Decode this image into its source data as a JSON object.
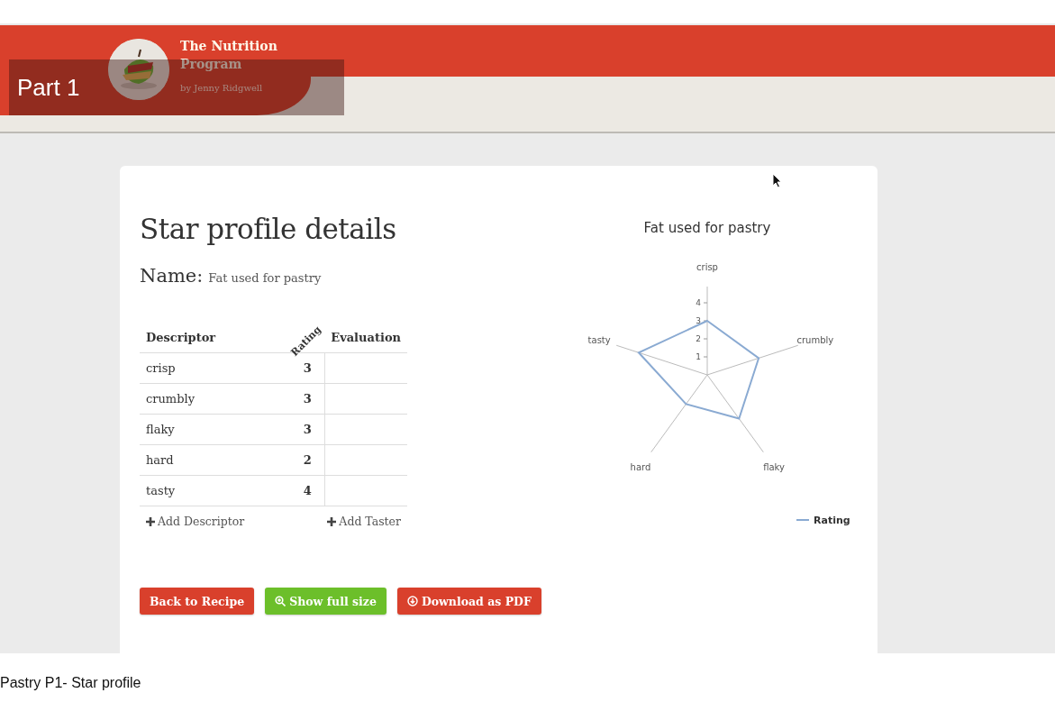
{
  "header": {
    "site_title": "The Nutrition Program",
    "byline": "by Jenny Ridgwell"
  },
  "video_overlay": {
    "label": "Part 1"
  },
  "page": {
    "heading": "Star profile details",
    "name_label": "Name:",
    "name_value": "Fat used for pastry"
  },
  "table": {
    "columns": [
      "Descriptor",
      "Rating",
      "Evaluation"
    ],
    "rows": [
      {
        "descriptor": "crisp",
        "rating": "3"
      },
      {
        "descriptor": "crumbly",
        "rating": "3"
      },
      {
        "descriptor": "flaky",
        "rating": "3"
      },
      {
        "descriptor": "hard",
        "rating": "2"
      },
      {
        "descriptor": "tasty",
        "rating": "4"
      }
    ],
    "add_links": [
      "Add Descriptor",
      "Add Taster"
    ]
  },
  "buttons": [
    {
      "label": "Back to Recipe",
      "kind": "back"
    },
    {
      "label": "Show full size",
      "kind": "zoom"
    },
    {
      "label": "Download as PDF",
      "kind": "download"
    }
  ],
  "chart": {
    "title": "Fat used for pastry",
    "axis_labels": [
      "crisp",
      "crumbly",
      "flaky",
      "hard",
      "tasty"
    ],
    "tick_labels": [
      "4",
      "3",
      "2",
      "1"
    ],
    "legend": "Rating"
  },
  "caption": "Pastry P1- Star profile"
}
